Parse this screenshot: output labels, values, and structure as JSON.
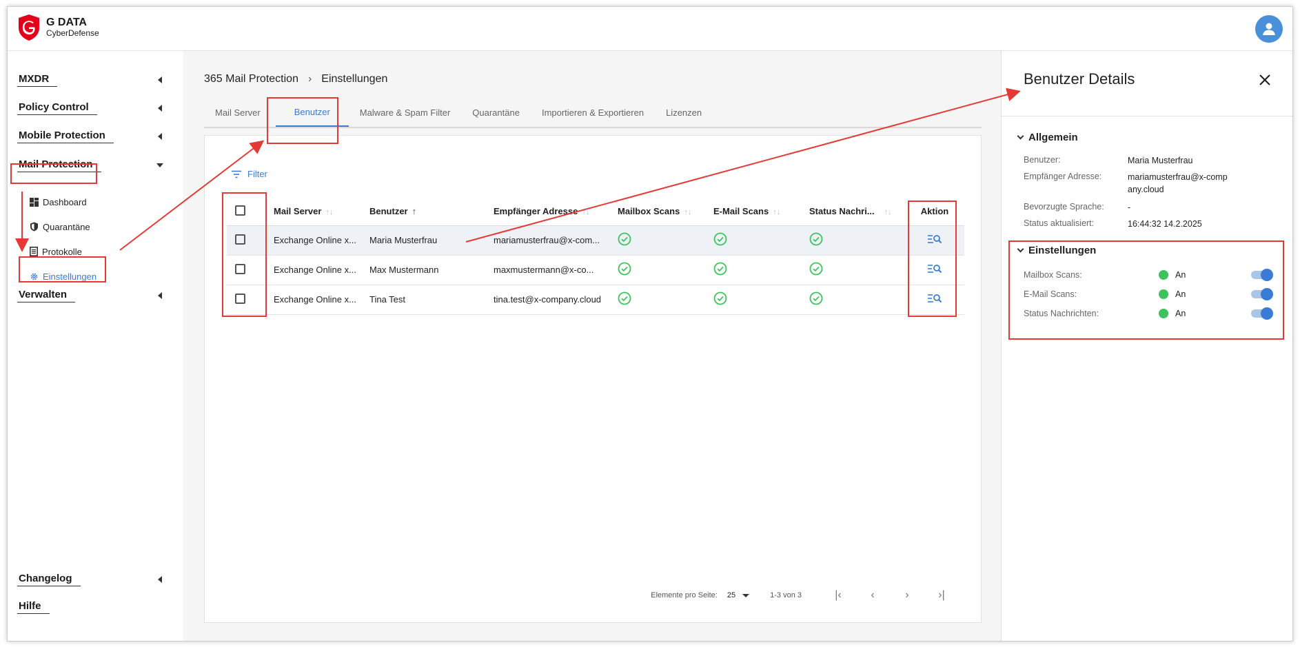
{
  "header": {
    "brand": "G DATA",
    "brand_sub": "CyberDefense"
  },
  "sidebar": {
    "items": [
      {
        "label": "MXDR"
      },
      {
        "label": "Policy Control"
      },
      {
        "label": "Mobile Protection"
      },
      {
        "label": "Mail Protection"
      },
      {
        "label": "Verwalten"
      },
      {
        "label": "Changelog"
      },
      {
        "label": "Hilfe"
      }
    ],
    "sub_items": [
      {
        "label": "Dashboard",
        "icon": "dashboard-icon"
      },
      {
        "label": "Quarantäne",
        "icon": "shield-icon"
      },
      {
        "label": "Protokolle",
        "icon": "log-icon"
      },
      {
        "label": "Einstellungen",
        "icon": "gear-icon",
        "active": true
      }
    ]
  },
  "breadcrumb": {
    "parent": "365 Mail Protection",
    "current": "Einstellungen"
  },
  "tabs": [
    {
      "label": "Mail Server"
    },
    {
      "label": "Benutzer",
      "active": true
    },
    {
      "label": "Malware & Spam Filter"
    },
    {
      "label": "Quarantäne"
    },
    {
      "label": "Importieren & Exportieren"
    },
    {
      "label": "Lizenzen"
    }
  ],
  "filter_label": "Filter",
  "table": {
    "columns": [
      "Mail Server",
      "Benutzer",
      "Empfänger Adresse",
      "Mailbox Scans",
      "E-Mail Scans",
      "Status Nachri...",
      "Aktion"
    ],
    "rows": [
      {
        "server": "Exchange Online x...",
        "user": "Maria Musterfrau",
        "address": "mariamusterfrau@x-com...",
        "mailbox": true,
        "email": true,
        "status": true
      },
      {
        "server": "Exchange Online x...",
        "user": "Max Mustermann",
        "address": "maxmustermann@x-co...",
        "mailbox": true,
        "email": true,
        "status": true
      },
      {
        "server": "Exchange Online x...",
        "user": "Tina Test",
        "address": "tina.test@x-company.cloud",
        "mailbox": true,
        "email": true,
        "status": true
      }
    ]
  },
  "paginator": {
    "label": "Elemente pro Seite:",
    "page_size": "25",
    "range": "1-3 von 3"
  },
  "panel": {
    "title": "Benutzer Details",
    "general": {
      "heading": "Allgemein",
      "fields": [
        {
          "key": "Benutzer:",
          "value": "Maria Musterfrau"
        },
        {
          "key": "Empfänger Adresse:",
          "value": "mariamusterfrau@x-company.cloud"
        },
        {
          "key": "Bevorzugte Sprache:",
          "value": "-"
        },
        {
          "key": "Status aktualisiert:",
          "value": "16:44:32 14.2.2025"
        }
      ]
    },
    "settings": {
      "heading": "Einstellungen",
      "rows": [
        {
          "key": "Mailbox Scans:",
          "value": "An",
          "enabled": true
        },
        {
          "key": "E-Mail Scans:",
          "value": "An",
          "enabled": true
        },
        {
          "key": "Status Nachrichten:",
          "value": "An",
          "enabled": true
        }
      ]
    }
  },
  "colors": {
    "accent": "#3a7bd5",
    "success": "#3cc35c",
    "annotation": "#e53935",
    "brand_red": "#e2001a"
  }
}
